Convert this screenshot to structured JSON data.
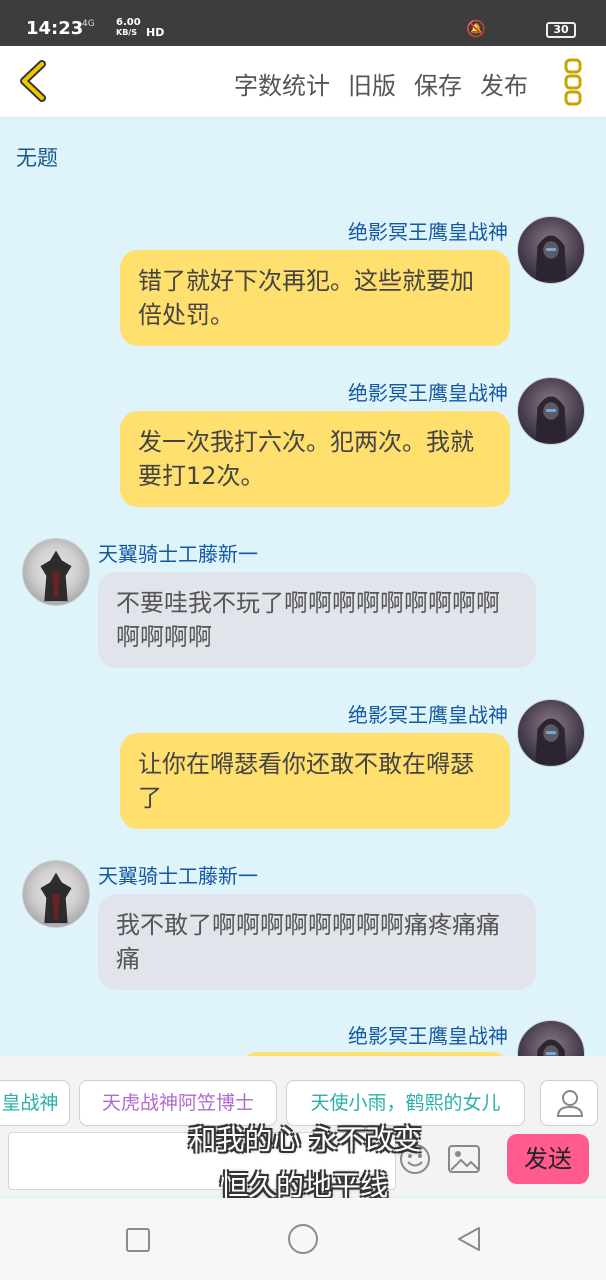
{
  "status_bar": {
    "time": "14:23",
    "network": "4G",
    "speed_value": "6.00",
    "speed_unit": "KB/S",
    "hd": "HD",
    "battery": "30"
  },
  "toolbar": {
    "word_count": "字数统计",
    "old_version": "旧版",
    "save": "保存",
    "publish": "发布"
  },
  "title": "无题",
  "messages": [
    {
      "side": "right",
      "author": "绝影冥王鹰皇战神",
      "text": "错了就好下次再犯。这些就要加倍处罚。"
    },
    {
      "side": "right",
      "author": "绝影冥王鹰皇战神",
      "text": "发一次我打六次。犯两次。我就要打12次。"
    },
    {
      "side": "left",
      "author": "天翼骑士工藤新一",
      "text": "不要哇我不玩了啊啊啊啊啊啊啊啊啊啊啊啊啊"
    },
    {
      "side": "right",
      "author": "绝影冥王鹰皇战神",
      "text": "让你在嘚瑟看你还敢不敢在嘚瑟了"
    },
    {
      "side": "left",
      "author": "天翼骑士工藤新一",
      "text": "我不敢了啊啊啊啊啊啊啊啊痛疼痛痛痛"
    },
    {
      "side": "right",
      "author": "绝影冥王鹰皇战神",
      "text": ""
    }
  ],
  "characters": [
    "皇战神",
    "天虎战神阿笠博士",
    "天使小雨，鹤熙的女儿"
  ],
  "input": {
    "value": "",
    "send": "发送"
  },
  "subtitles": {
    "line1": "和我的心 永不改变",
    "line2": "恒久的地平线"
  },
  "colors": {
    "bubble_right": "#ffdf6e",
    "bubble_left": "#e1e4ea",
    "send_button": "#ff5b8f",
    "name_color": "#155aa0",
    "menu_accent": "#c8a400"
  }
}
